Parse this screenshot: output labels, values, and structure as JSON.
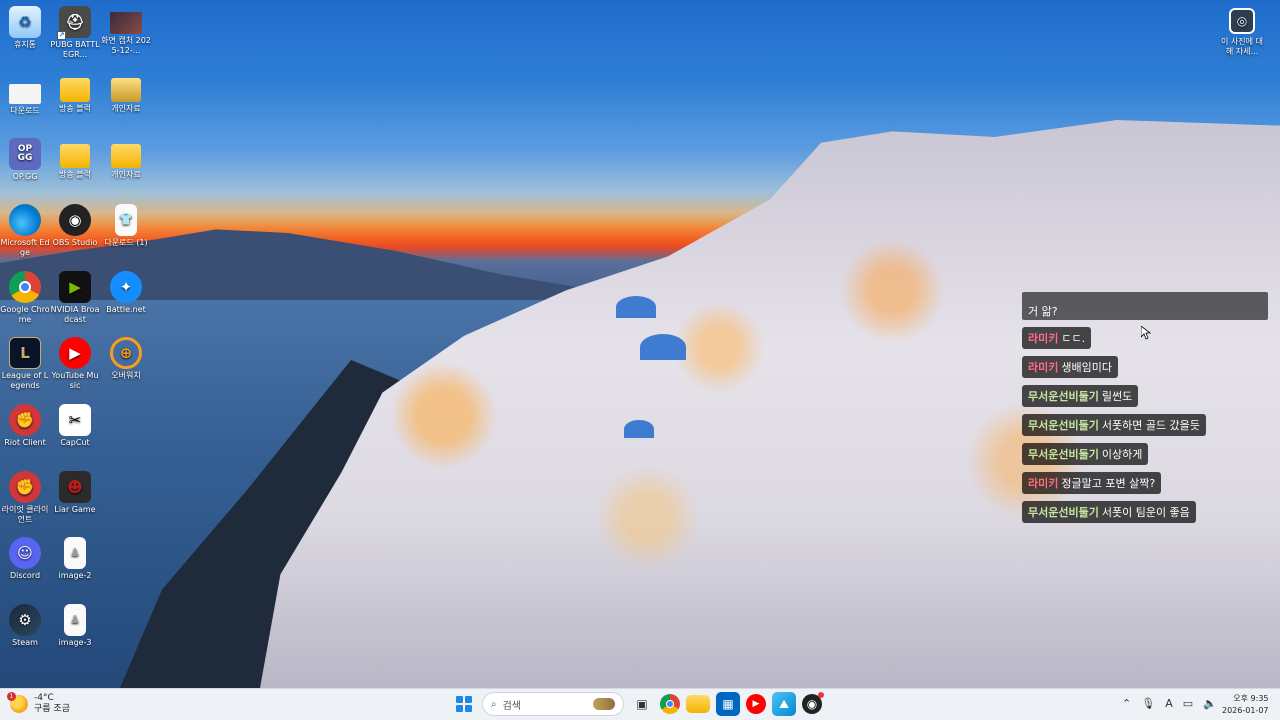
{
  "desktop": {
    "icons": [
      {
        "label": "휴지통",
        "icon": "recycle-bin-icon"
      },
      {
        "label": "PUBG BATTLEGR...",
        "icon": "pubg-icon"
      },
      {
        "label": "화면 캡처 2025-12-...",
        "icon": "screenshot-icon"
      },
      {
        "label": "다운로드",
        "icon": "download-icon"
      },
      {
        "label": "방송 블럭",
        "icon": "folder-icon"
      },
      {
        "label": "개인자료",
        "icon": "folder-icon"
      },
      {
        "label": "OP.GG",
        "icon": "opgg-icon"
      },
      {
        "label": "방송 블럭",
        "icon": "folder-icon"
      },
      {
        "label": "개인자료",
        "icon": "folder-icon"
      },
      {
        "label": "Microsoft Edge",
        "icon": "edge-icon"
      },
      {
        "label": "OBS Studio",
        "icon": "obs-icon"
      },
      {
        "label": "다운로드 (1)",
        "icon": "file-icon"
      },
      {
        "label": "Google Chrome",
        "icon": "chrome-icon"
      },
      {
        "label": "NVIDIA Broadcast",
        "icon": "nvidia-icon"
      },
      {
        "label": "Battle.net",
        "icon": "battlenet-icon"
      },
      {
        "label": "League of Legends",
        "icon": "lol-icon"
      },
      {
        "label": "YouTube Music",
        "icon": "youtube-music-icon"
      },
      {
        "label": "오버워치",
        "icon": "overwatch-icon"
      },
      {
        "label": "Riot Client",
        "icon": "riot-icon"
      },
      {
        "label": "CapCut",
        "icon": "capcut-icon"
      },
      {
        "label": "라이엇 클라이언트",
        "icon": "riot-icon"
      },
      {
        "label": "Liar Game",
        "icon": "liar-game-icon"
      },
      {
        "label": "Discord",
        "icon": "discord-icon"
      },
      {
        "label": "image-2",
        "icon": "image-file-icon"
      },
      {
        "label": "Steam",
        "icon": "steam-icon"
      },
      {
        "label": "image-3",
        "icon": "image-file-icon"
      }
    ],
    "learn_more": {
      "label": "이 사진에 대해 자세..."
    }
  },
  "chat": {
    "top_partial": "거 앎?",
    "messages": [
      {
        "user": "라미키",
        "text": "ㄷㄷ.",
        "color": "#ff6b81"
      },
      {
        "user": "라미키",
        "text": "생배임미다",
        "color": "#ff6b81"
      },
      {
        "user": "무서운선비둘기",
        "text": "릴썬도",
        "color": "#c8e6a0"
      },
      {
        "user": "무서운선비둘기",
        "text": "서폿하면 골드 갔을듯",
        "color": "#c8e6a0"
      },
      {
        "user": "무서운선비둘기",
        "text": "이상하게",
        "color": "#c8e6a0"
      },
      {
        "user": "라미키",
        "text": "정글말고 포변 살짝?",
        "color": "#ff6b81"
      },
      {
        "user": "무서운선비둘기",
        "text": "서폿이 팀운이 좋음",
        "color": "#c8e6a0"
      }
    ]
  },
  "taskbar": {
    "weather": {
      "temp": "-4°C",
      "desc": "구름 조금",
      "badge": "1"
    },
    "search_placeholder": "검색",
    "apps": [
      "start-icon",
      "search",
      "task-view-icon",
      "chrome-icon",
      "file-explorer-icon",
      "store-icon",
      "youtube-music-icon",
      "photos-icon",
      "obs-icon"
    ],
    "clock": {
      "time": "오후 9:35",
      "date": "2026-01-07"
    },
    "tray_input": "A"
  }
}
